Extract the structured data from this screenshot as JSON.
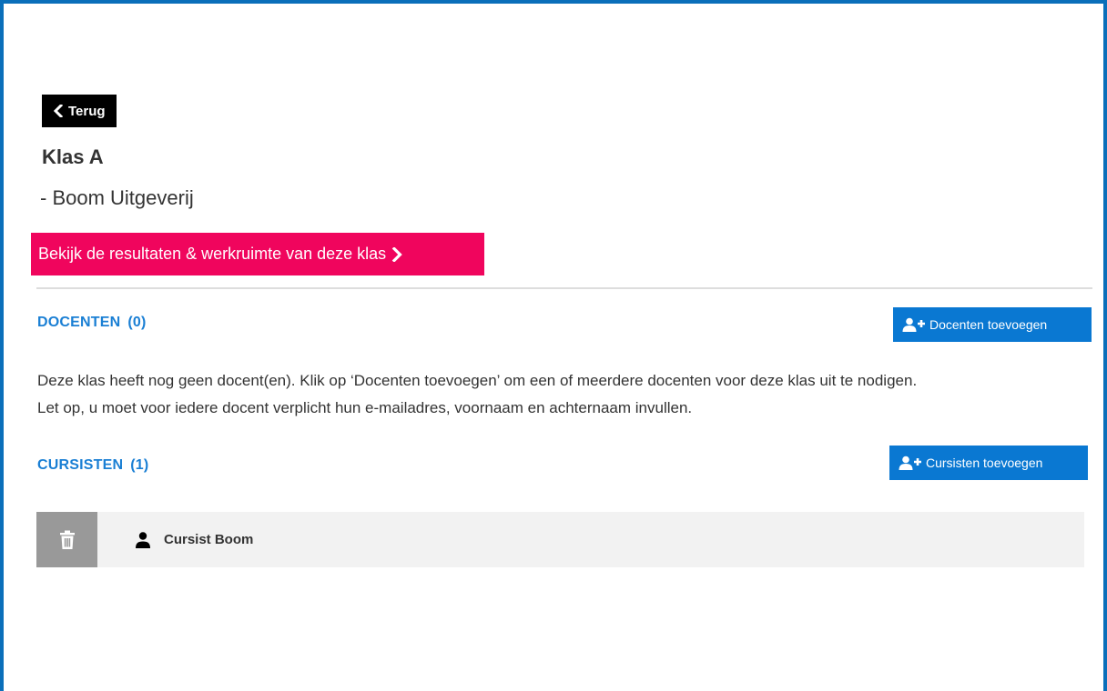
{
  "nav": {
    "back_label": "Terug",
    "back_icon": "chevron-left-icon"
  },
  "class_info": {
    "title": "Klas A",
    "subtitle": "- Boom Uitgeverij"
  },
  "results_link": {
    "label": "Bekijk de resultaten & werkruimte van deze klas",
    "icon": "chevron-right-icon",
    "color": "#f0055d"
  },
  "teachers": {
    "heading": "DOCENTEN",
    "count": "(0)",
    "add_button_label": "Docenten toevoegen",
    "add_button_icon": "add-user-icon",
    "empty_message_line1": "Deze klas heeft nog geen docent(en). Klik op ‘Docenten toevoegen’ om een of meerdere docenten voor deze klas uit te nodigen.",
    "empty_message_line2": "Let op, u moet voor iedere docent verplicht hun e-mailadres, voornaam en achternaam invullen."
  },
  "students": {
    "heading": "CURSISTEN",
    "count": "(1)",
    "add_button_label": "Cursisten toevoegen",
    "add_button_icon": "add-user-icon",
    "items": [
      {
        "name": "Cursist Boom",
        "icon": "person-icon",
        "delete_icon": "trash-icon"
      }
    ]
  },
  "colors": {
    "accent_blue": "#0a78d2",
    "heading_blue": "#1a7fd4",
    "frame_border": "#0a6fba",
    "delete_gray": "#999999",
    "row_background": "#f2f2f2"
  }
}
